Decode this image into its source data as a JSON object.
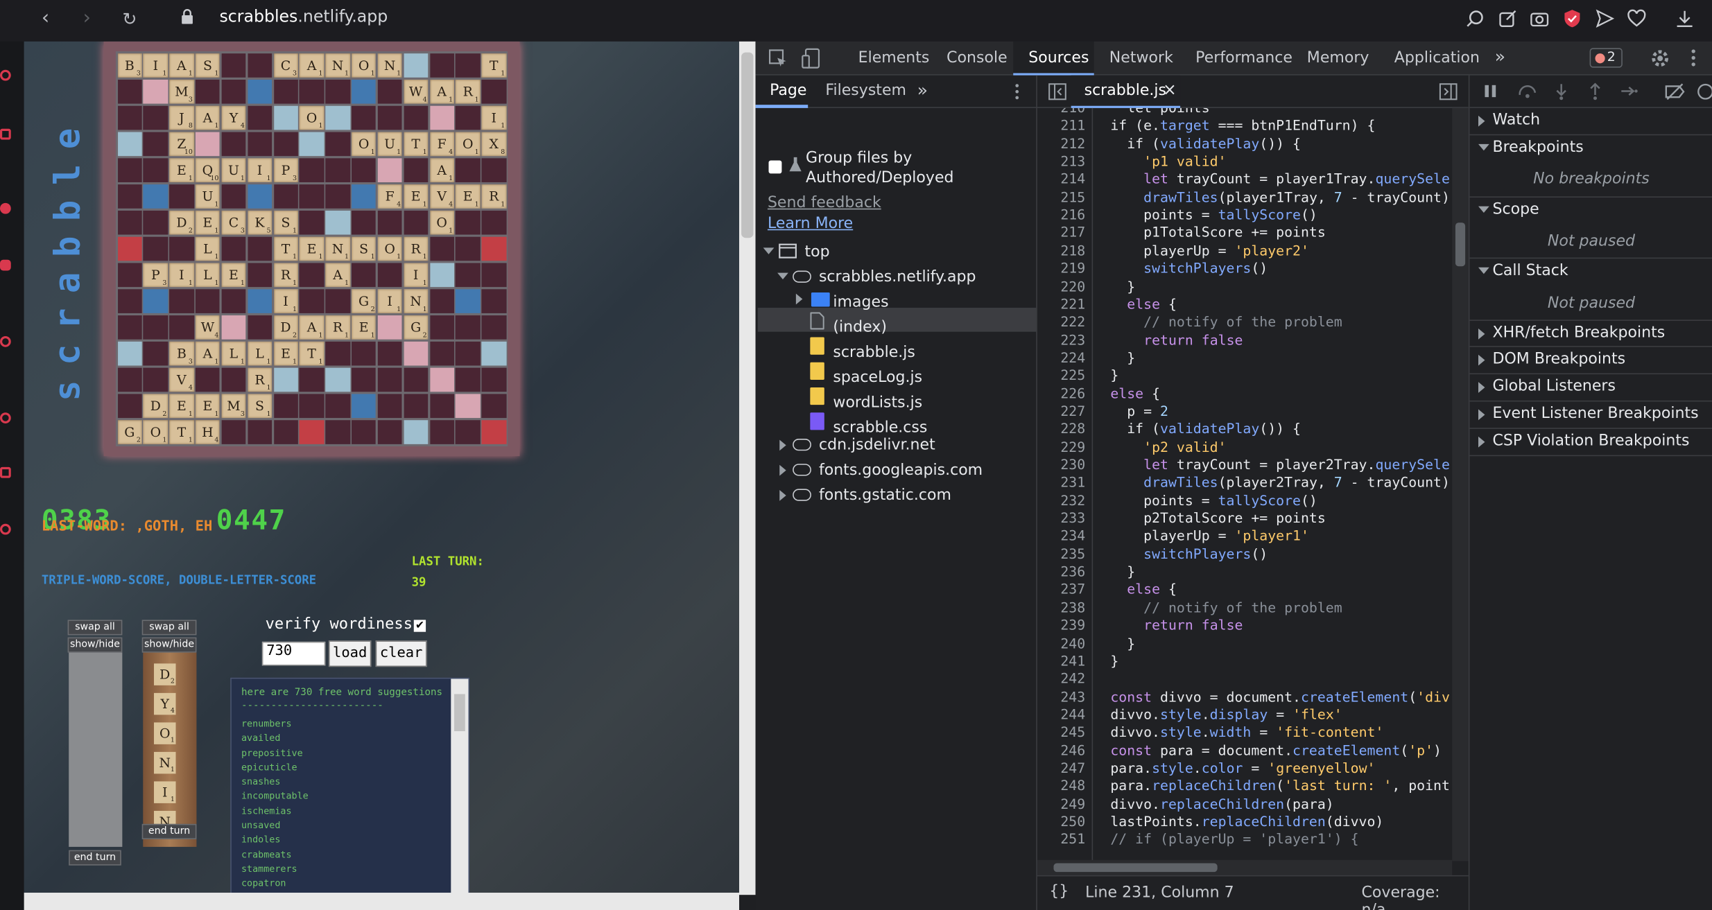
{
  "browser": {
    "url_host": "scrabbles",
    "url_domain": ".netlify.app"
  },
  "game": {
    "title_letters": [
      "s",
      "c",
      "r",
      "a",
      "b",
      "b",
      "l",
      "e"
    ],
    "p1_score": "0383",
    "p2_score": "0447",
    "last_word": "LAST-WORD: ,GOTH, EH",
    "score_type": "TRIPLE-WORD-SCORE, DOUBLE-LETTER-SCORE",
    "last_turn_label": "LAST TURN:",
    "last_turn_value": "39",
    "swap_all": "swap all",
    "show_hide": "show/hide",
    "end_turn": "end turn",
    "tray2_tiles": [
      "D",
      "Y",
      "O",
      "N",
      "I",
      "N"
    ],
    "verify_label": "verify wordiness",
    "verify_checked": "✔",
    "count_value": "730",
    "load": "load",
    "clear": "clear",
    "suggest_header": "here are 730 free word suggestions",
    "suggest_rule": "------------------------",
    "suggestions": [
      "renumbers",
      "availed",
      "prepositive",
      "epicuticle",
      "snashes",
      "incomputable",
      "ischemias",
      "unsaved",
      "indoles",
      "crabmeats",
      "stammerers",
      "copatron"
    ]
  },
  "devtools": {
    "tabs": [
      "Elements",
      "Console",
      "Sources",
      "Network",
      "Performance",
      "Memory",
      "Application"
    ],
    "more": "»",
    "errors": "2",
    "nav_tabs": [
      "Page",
      "Filesystem"
    ],
    "group_files": "Group files by Authored/Deployed",
    "send_feedback": "Send feedback",
    "learn_more": "Learn More",
    "tree": {
      "top": "top",
      "site": "scrabbles.netlify.app",
      "images": "images",
      "index": "(index)",
      "files": [
        "scrabble.js",
        "spaceLog.js",
        "wordLists.js",
        "scrabble.css"
      ],
      "hosts": [
        "cdn.jsdelivr.net",
        "fonts.googleapis.com",
        "fonts.gstatic.com"
      ]
    },
    "editor_tab": "scrabble.js",
    "close": "×",
    "status_pos": "Line 231, Column 7",
    "coverage": "Coverage: n/a",
    "braces": "{}",
    "debugger": {
      "watch": "Watch",
      "breakpoints": "Breakpoints",
      "no_breakpoints": "No breakpoints",
      "scope": "Scope",
      "not_paused": "Not paused",
      "call_stack": "Call Stack",
      "not_paused_2": "Not paused",
      "xhr": "XHR/fetch Breakpoints",
      "dom": "DOM Breakpoints",
      "global": "Global Listeners",
      "event": "Event Listener Breakpoints",
      "csp": "CSP Violation Breakpoints"
    }
  },
  "code_lines": [
    {
      "n": "210",
      "html": "  <span>let points</span>"
    },
    {
      "n": "211",
      "html": "if (e.<span class=\"m\">target</span> === btnP1EndTurn) {"
    },
    {
      "n": "212",
      "html": "  if (<span class=\"m\">validatePlay</span>()) {"
    },
    {
      "n": "213",
      "html": "    <span class=\"s\">'p1 valid'</span>"
    },
    {
      "n": "214",
      "html": "    <span class=\"k\">let</span> trayCount = player1Tray.<span class=\"m\">querySele</span>"
    },
    {
      "n": "215",
      "html": "    <span class=\"m\">drawTiles</span>(player1Tray, <span class=\"n\">7</span> - trayCount)"
    },
    {
      "n": "216",
      "html": "    points = <span class=\"m\">tallyScore</span>()"
    },
    {
      "n": "217",
      "html": "    p1TotalScore += points"
    },
    {
      "n": "218",
      "html": "    playerUp = <span class=\"s\">'player2'</span>"
    },
    {
      "n": "219",
      "html": "    <span class=\"m\">switchPlayers</span>()"
    },
    {
      "n": "220",
      "html": "  }"
    },
    {
      "n": "221",
      "html": "  <span class=\"k\">else</span> {"
    },
    {
      "n": "222",
      "html": "    <span class=\"cm\">// notify of the problem</span>"
    },
    {
      "n": "223",
      "html": "    <span class=\"k\">return</span> <span class=\"k\">false</span>"
    },
    {
      "n": "224",
      "html": "  }"
    },
    {
      "n": "225",
      "html": "}"
    },
    {
      "n": "226",
      "html": "<span class=\"k\">else</span> {"
    },
    {
      "n": "227",
      "html": "  p = <span class=\"n\">2</span>"
    },
    {
      "n": "228",
      "html": "  if (<span class=\"m\">validatePlay</span>()) {"
    },
    {
      "n": "229",
      "html": "    <span class=\"s\">'p2 valid'</span>"
    },
    {
      "n": "230",
      "html": "    <span class=\"k\">let</span> trayCount = player2Tray.<span class=\"m\">querySele</span>"
    },
    {
      "n": "231",
      "html": "    <span class=\"m\">drawTiles</span>(player2Tray, <span class=\"n\">7</span> - trayCount)"
    },
    {
      "n": "232",
      "html": "    points = <span class=\"m\">tallyScore</span>()"
    },
    {
      "n": "233",
      "html": "    p2TotalScore += points"
    },
    {
      "n": "234",
      "html": "    playerUp = <span class=\"s\">'player1'</span>"
    },
    {
      "n": "235",
      "html": "    <span class=\"m\">switchPlayers</span>()"
    },
    {
      "n": "236",
      "html": "  }"
    },
    {
      "n": "237",
      "html": "  <span class=\"k\">else</span> {"
    },
    {
      "n": "238",
      "html": "    <span class=\"cm\">// notify of the problem</span>"
    },
    {
      "n": "239",
      "html": "    <span class=\"k\">return</span> <span class=\"k\">false</span>"
    },
    {
      "n": "240",
      "html": "  }"
    },
    {
      "n": "241",
      "html": "}"
    },
    {
      "n": "242",
      "html": ""
    },
    {
      "n": "243",
      "html": "<span class=\"k\">const</span> divvo = document.<span class=\"m\">createElement</span>(<span class=\"s\">'div</span>"
    },
    {
      "n": "244",
      "html": "divvo.<span class=\"m\">style</span>.<span class=\"m\">display</span> = <span class=\"s\">'flex'</span>"
    },
    {
      "n": "245",
      "html": "divvo.<span class=\"m\">style</span>.<span class=\"m\">width</span> = <span class=\"s\">'fit-content'</span>"
    },
    {
      "n": "246",
      "html": "<span class=\"k\">const</span> para = document.<span class=\"m\">createElement</span>(<span class=\"s\">'p'</span>)"
    },
    {
      "n": "247",
      "html": "para.<span class=\"m\">style</span>.<span class=\"m\">color</span> = <span class=\"s\">'greenyellow'</span>"
    },
    {
      "n": "248",
      "html": "para.<span class=\"m\">replaceChildren</span>(<span class=\"s\">'last turn: '</span>, point"
    },
    {
      "n": "249",
      "html": "divvo.<span class=\"m\">replaceChildren</span>(para)"
    },
    {
      "n": "250",
      "html": "lastPoints.<span class=\"m\">replaceChildren</span>(divvo)"
    },
    {
      "n": "251",
      "html": "<span class=\"cm\">// if (playerUp = 'player1') {</span>"
    }
  ],
  "board": [
    "B I A S _ _ C A N O N _ _ _ T",
    "_ _ M _ _ _ _ _ _ _ _ W A R _",
    "_ _ J A Y _ _ O _ _ _ _ _ _ I",
    "_ _ Z _ _ _ _ _ _ O U T F O X",
    "_ _ E Q U I P _ _ _ _ _ A _ _",
    "_ _ _ U _ _ _ _ _ _ F E V E R",
    "_ _ D E C K S _ _ _ _ _ O _ _",
    "_ _ _ L _ _ T E N S O R _ _ _",
    "_ P I L E _ R _ A _ _ I _ _ _",
    "_ _ _ _ _ _ I _ _ G I N _ _ _",
    "_ _ _ W _ _ D A R E _ G _ _ _",
    "_ _ B A L L E T _ _ _ _ _ _ _",
    "_ _ V _ _ R _ _ _ _ _ _ _ _ _",
    "_ D E E M S _ _ _ _ _ _ _ _ _",
    "G O T H _ _ _ _ _ _ _ _ _ _ _"
  ]
}
